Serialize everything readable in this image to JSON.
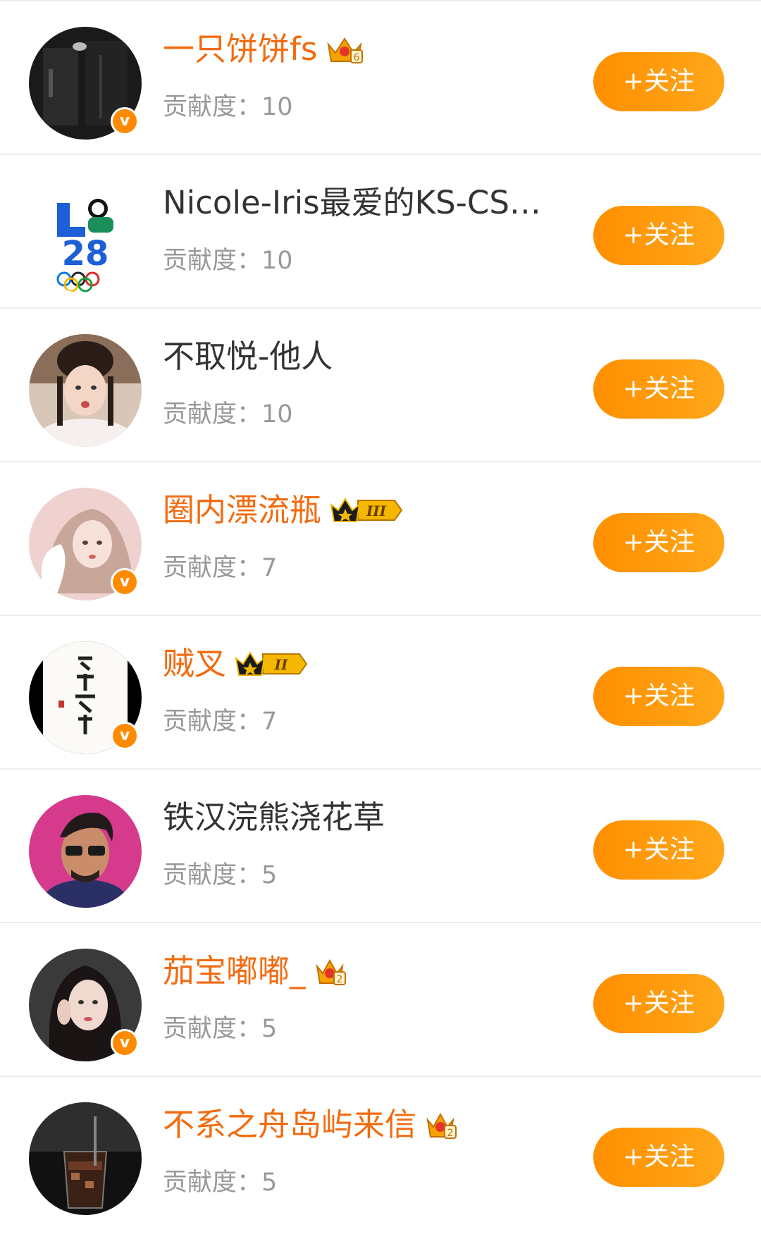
{
  "follow_label": "+关注",
  "contribution_prefix": "贡献度：",
  "colors": {
    "accent_orange": "#ff8f00",
    "vip_name": "#f26b0f",
    "normal_name": "#333333",
    "muted": "#999999",
    "divider": "#ececec"
  },
  "users": [
    {
      "name": "一只饼饼fs",
      "vip": true,
      "verified": true,
      "badge_icon": "crown-6-icon",
      "badge_text": "6",
      "contribution": "10",
      "avatar_icon": "dark-room-avatar"
    },
    {
      "name": "Nicole-Iris最爱的KS-CS…",
      "vip": false,
      "verified": false,
      "badge_icon": "",
      "badge_text": "",
      "contribution": "10",
      "avatar_icon": "la28-olympics-avatar",
      "avatar_text": "28"
    },
    {
      "name": "不取悦-他人",
      "vip": false,
      "verified": false,
      "badge_icon": "",
      "badge_text": "",
      "contribution": "10",
      "avatar_icon": "costume-woman-avatar"
    },
    {
      "name": "圈内漂流瓶",
      "vip": true,
      "verified": true,
      "badge_icon": "crown-level-icon",
      "badge_text": "III",
      "contribution": "7",
      "avatar_icon": "swan-girl-avatar"
    },
    {
      "name": "贼叉",
      "vip": true,
      "verified": true,
      "badge_icon": "crown-level-icon",
      "badge_text": "II",
      "contribution": "7",
      "avatar_icon": "calligraphy-avatar"
    },
    {
      "name": "铁汉浣熊浇花草",
      "vip": false,
      "verified": false,
      "badge_icon": "",
      "badge_text": "",
      "contribution": "5",
      "avatar_icon": "sunglasses-man-avatar"
    },
    {
      "name": "茄宝嘟嘟_",
      "vip": true,
      "verified": true,
      "badge_icon": "crown-2-icon",
      "badge_text": "2",
      "contribution": "5",
      "avatar_icon": "woman-portrait-avatar"
    },
    {
      "name": "不系之舟岛屿来信",
      "vip": true,
      "verified": false,
      "badge_icon": "crown-2-icon",
      "badge_text": "2",
      "contribution": "5",
      "avatar_icon": "iced-drink-avatar"
    }
  ]
}
